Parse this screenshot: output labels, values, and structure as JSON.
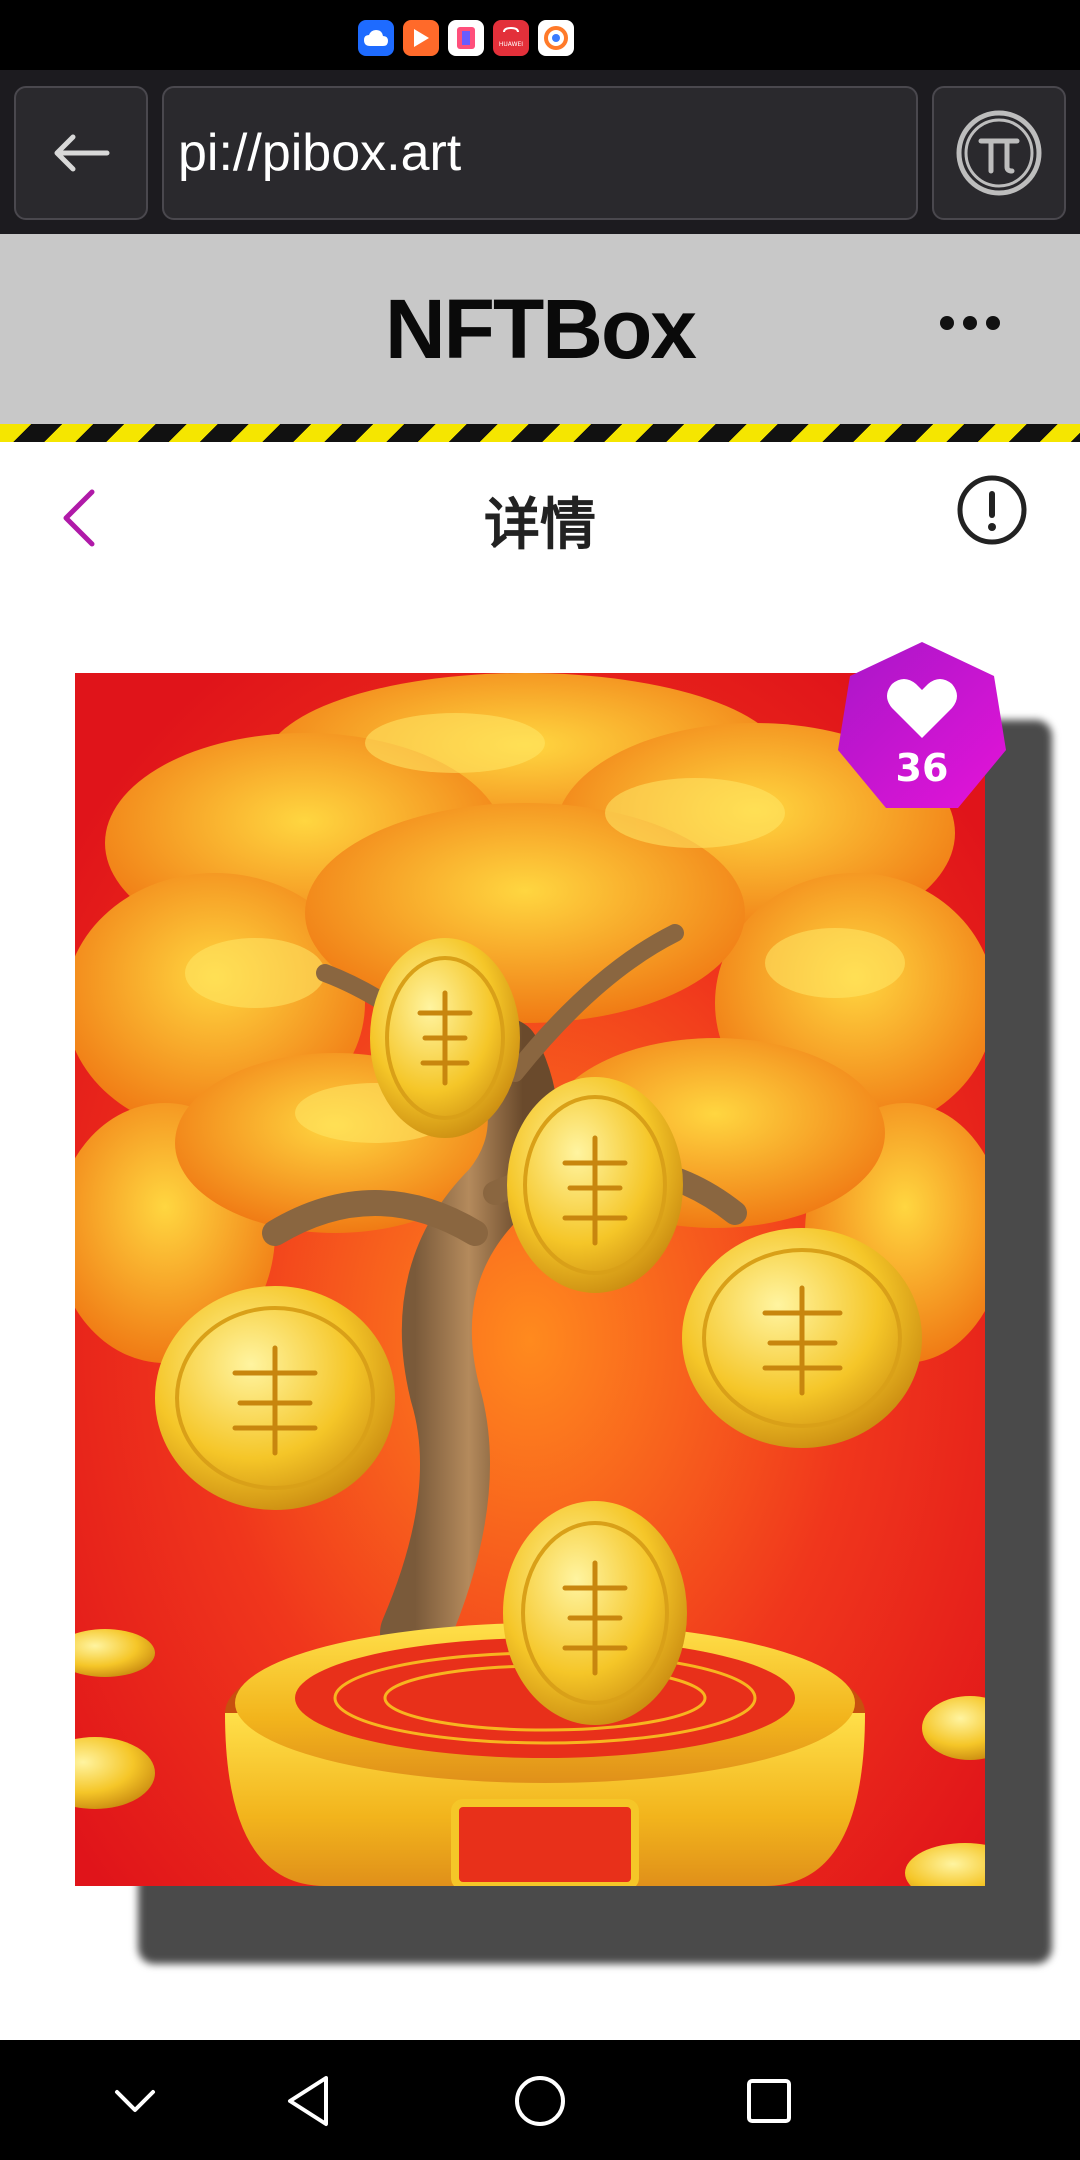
{
  "status_bar": {
    "apps": [
      "cloud-app-icon",
      "video-app-icon",
      "reader-app-icon",
      "huawei-store-icon",
      "browser-app-icon"
    ],
    "huawei_label": "HUAWEI"
  },
  "browser": {
    "url": "pi://pibox.art"
  },
  "app_header": {
    "title": "NFTBox"
  },
  "detail": {
    "title": "详情"
  },
  "nft": {
    "likes": "36"
  },
  "nav": {
    "buttons": [
      "collapse-icon",
      "back-triangle-icon",
      "home-circle-icon",
      "recents-square-icon"
    ]
  },
  "colors": {
    "accent": "#b01aa8",
    "header_bg": "#c8c8c8",
    "stripe_yellow": "#f5e600"
  }
}
